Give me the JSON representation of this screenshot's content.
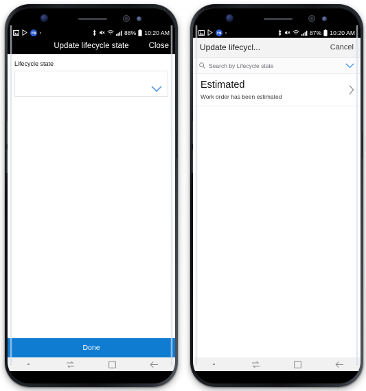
{
  "scene": {
    "description": "Two Samsung Galaxy phone mockups side by side showing a Dynamics 365 Field Service mobile app lifecycle state picker"
  },
  "accent": {
    "done_blue": "#0f7cd2",
    "chevron_blue": "#5c9bdd",
    "search_chevron_blue": "#4a9ae0",
    "status_badge_blue": "#2c5fd6"
  },
  "phone_left": {
    "status_bar": {
      "icons": [
        "image-icon",
        "play-store-icon",
        "app-badge-icon",
        "more-dot-icon"
      ],
      "badge_text": "mg",
      "right_icons": [
        "bluetooth-icon",
        "mute-icon",
        "wifi-icon",
        "signal-icon"
      ],
      "battery": "88%",
      "battery_icon": "battery-icon",
      "time": "10:20 AM"
    },
    "titlebar": {
      "title": "Update lifecycle state",
      "close_label": "Close"
    },
    "form": {
      "field_label": "Lifecycle state",
      "combo_value": "",
      "combo_placeholder": "",
      "chevron_icon": "chevron-down-icon"
    },
    "footer": {
      "done_label": "Done"
    },
    "navbar": {
      "items": [
        "dot-indicator",
        "recents-icon",
        "home-icon",
        "back-icon"
      ]
    }
  },
  "phone_right": {
    "status_bar": {
      "icons": [
        "image-icon",
        "play-store-icon",
        "app-badge-icon",
        "more-dot-icon"
      ],
      "badge_text": "mg",
      "right_icons": [
        "bluetooth-icon",
        "mute-icon",
        "wifi-icon",
        "signal-icon"
      ],
      "battery": "87%",
      "battery_icon": "battery-icon",
      "time": "10:20 AM"
    },
    "titlebar": {
      "title": "Update lifecycl...",
      "cancel_label": "Cancel"
    },
    "search": {
      "icon": "search-icon",
      "placeholder": "Search by Lifecycle state",
      "value": "",
      "chevron_icon": "chevron-down-icon"
    },
    "list": {
      "items": [
        {
          "title": "Estimated",
          "subtitle": "Work order has been estimated",
          "chevron_icon": "chevron-right-icon"
        }
      ]
    },
    "navbar": {
      "items": [
        "dot-indicator",
        "recents-icon",
        "home-icon",
        "back-icon"
      ]
    }
  }
}
